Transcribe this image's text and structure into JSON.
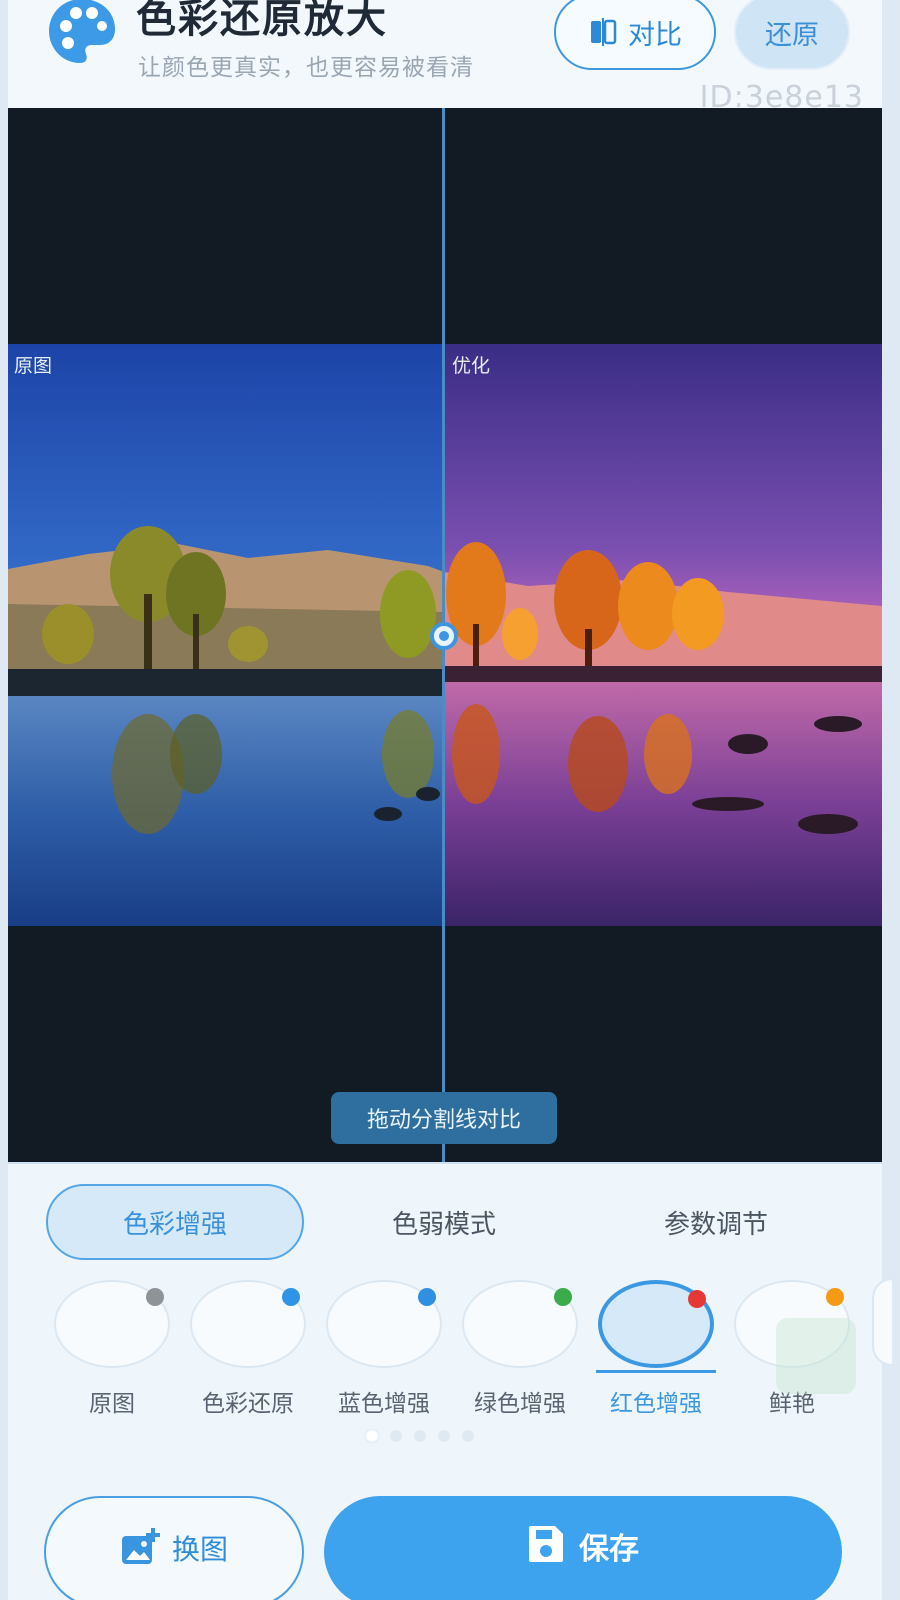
{
  "header": {
    "title": "色彩还原放大",
    "subtitle": "让颜色更真实，也更容易被看清",
    "compare_label": "对比",
    "restore_label": "还原",
    "id_tag": "ID:3e8e13"
  },
  "viewer": {
    "left_label": "原图",
    "right_label": "优化",
    "hint": "拖动分割线对比"
  },
  "tabs": [
    {
      "label": "色彩增强",
      "active": true
    },
    {
      "label": "色弱模式",
      "active": false
    },
    {
      "label": "参数调节",
      "active": false
    }
  ],
  "filters": [
    {
      "label": "原图",
      "dot_color": "#8e9397"
    },
    {
      "label": "色彩还原",
      "dot_color": "#2f93e6"
    },
    {
      "label": "蓝色增强",
      "dot_color": "#2f8fe0"
    },
    {
      "label": "绿色增强",
      "dot_color": "#3bab4c"
    },
    {
      "label": "红色增强",
      "dot_color": "#e53935",
      "active": true
    },
    {
      "label": "鲜艳",
      "dot_color": "#f59a14"
    }
  ],
  "pager": {
    "pages": 5,
    "current": 1
  },
  "actions": {
    "change_label": "换图",
    "save_label": "保存"
  },
  "colors": {
    "accent": "#3ea3ee",
    "canvas_bg": "#121b24"
  }
}
